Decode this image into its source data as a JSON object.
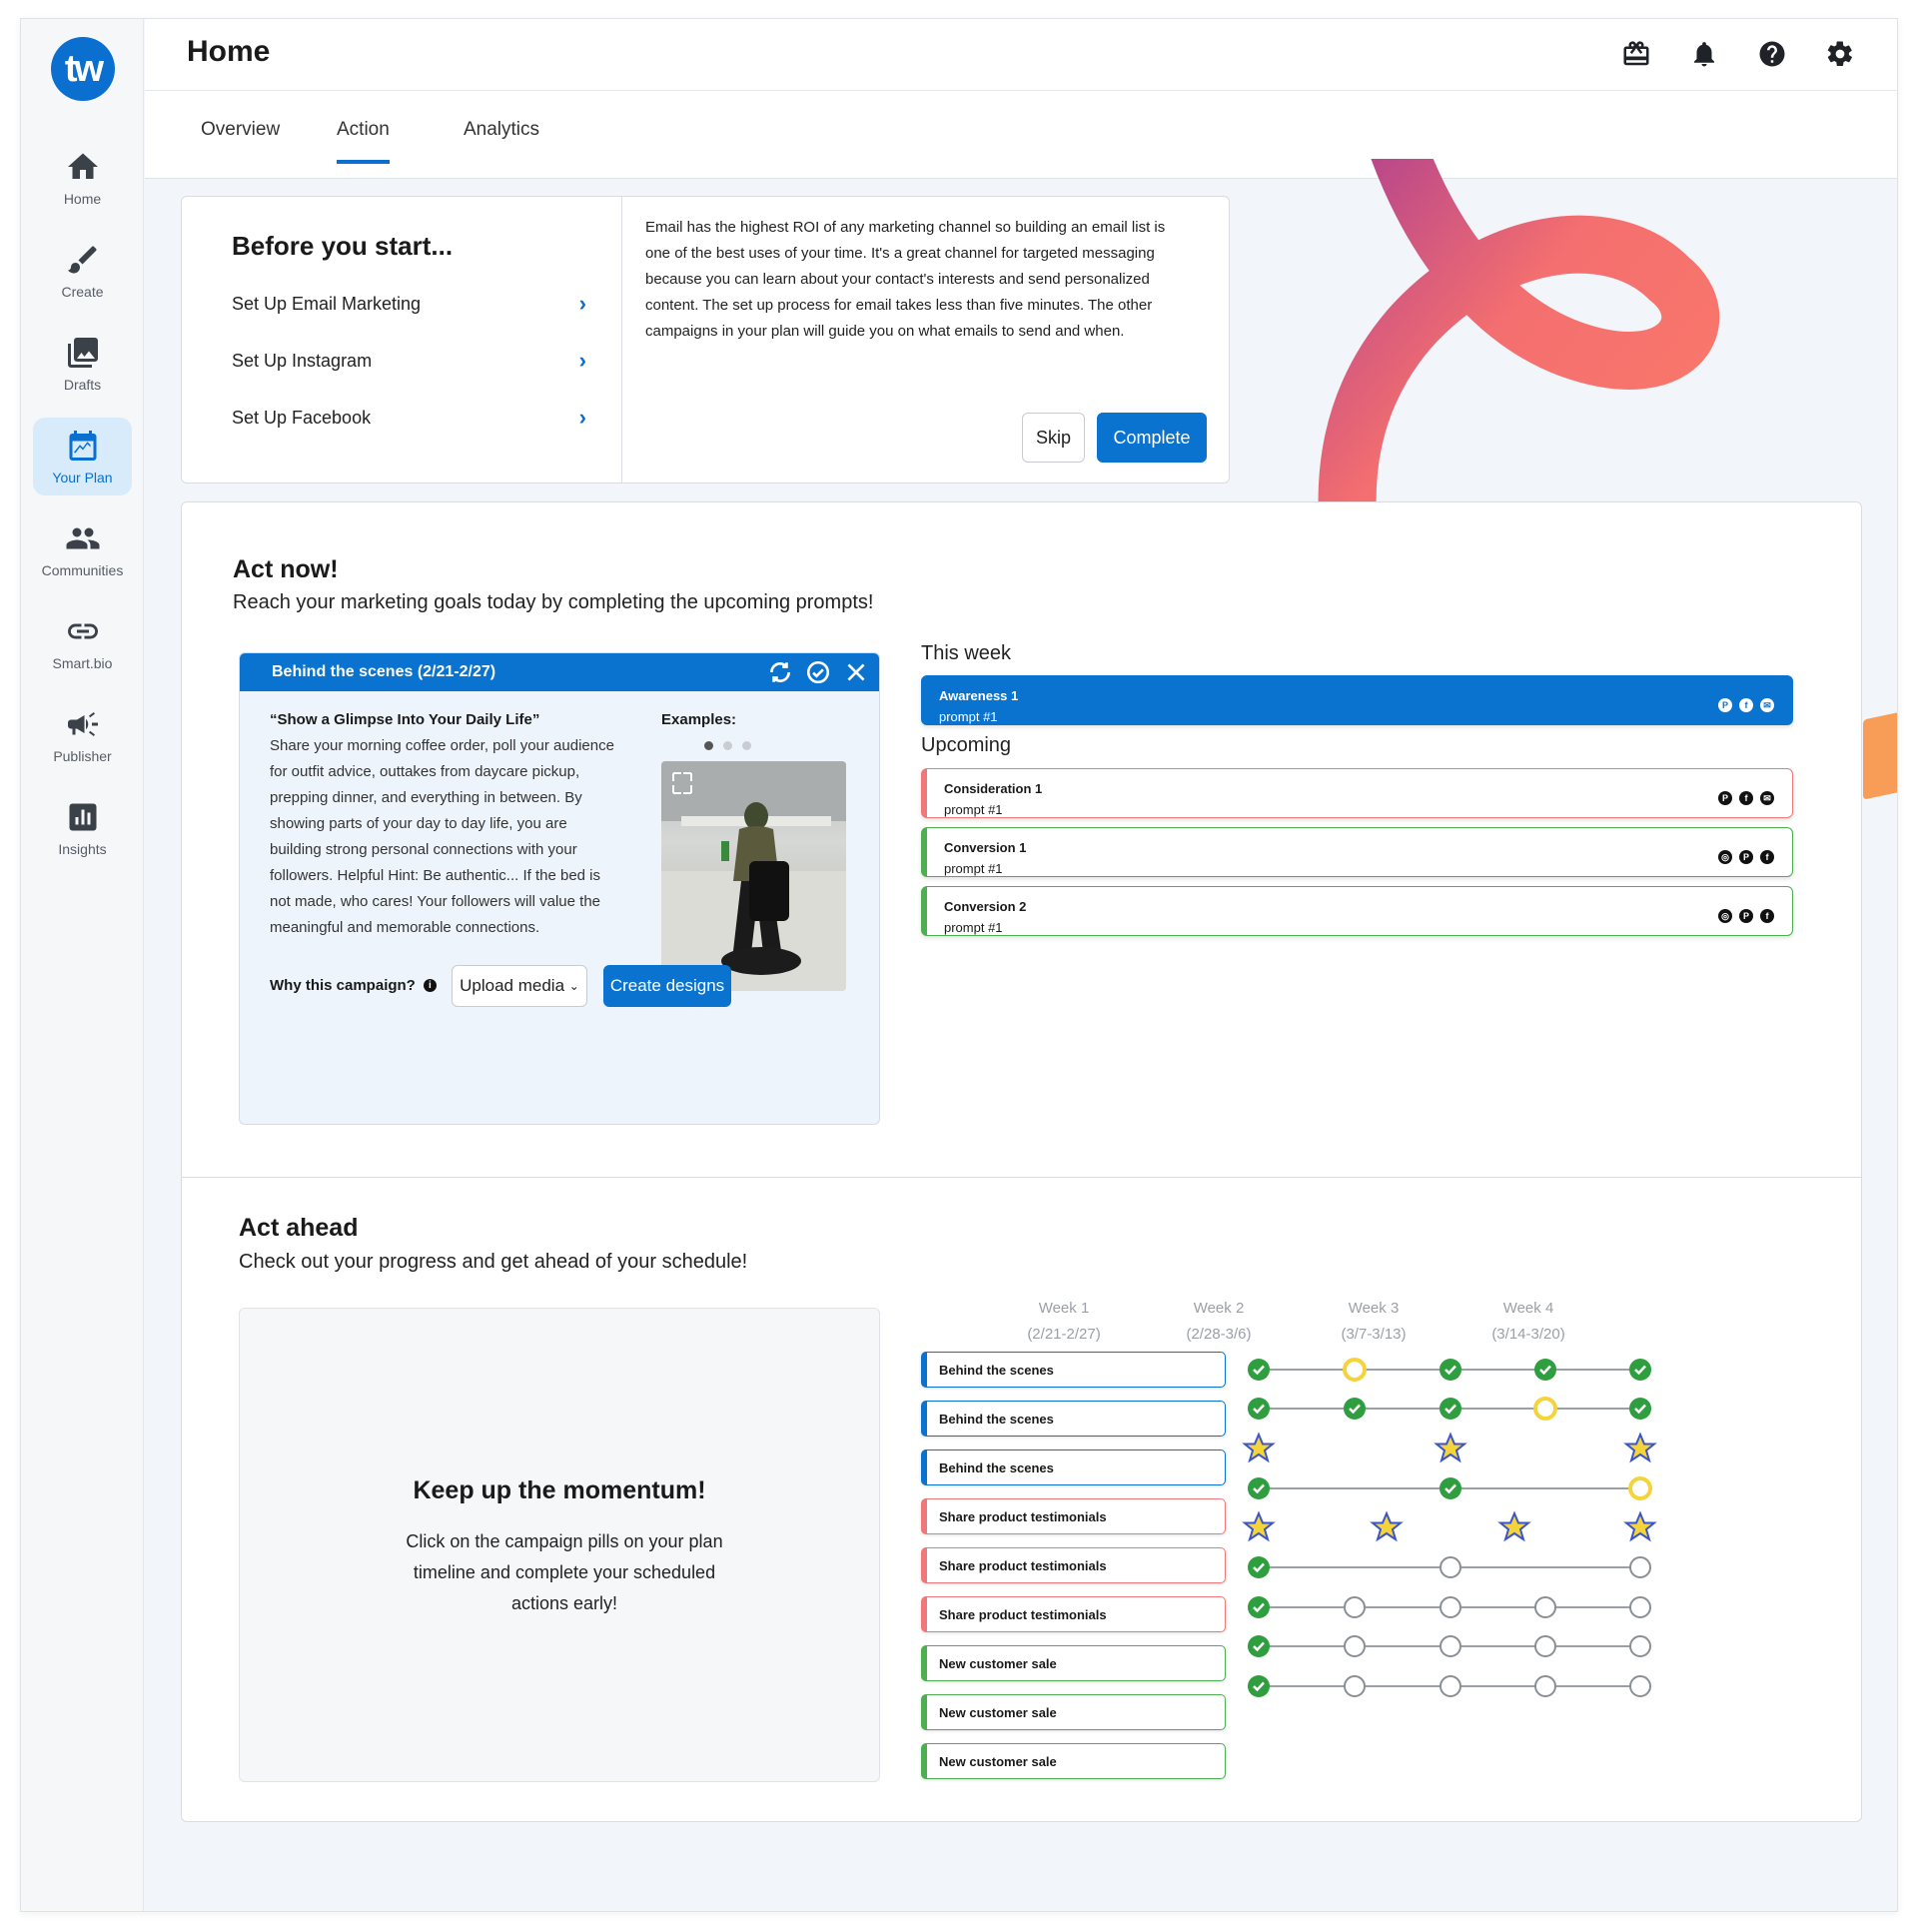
{
  "app": {
    "logo_text": "tw",
    "page_title": "Home"
  },
  "sidebar": {
    "items": [
      {
        "label": "Home",
        "icon": "home-icon"
      },
      {
        "label": "Create",
        "icon": "brush-icon"
      },
      {
        "label": "Drafts",
        "icon": "images-icon"
      },
      {
        "label": "Your Plan",
        "icon": "calendar-chart-icon",
        "active": true
      },
      {
        "label": "Communities",
        "icon": "people-icon"
      },
      {
        "label": "Smart.bio",
        "icon": "link-icon"
      },
      {
        "label": "Publisher",
        "icon": "megaphone-icon"
      },
      {
        "label": "Insights",
        "icon": "bar-chart-icon"
      }
    ]
  },
  "header_icons": [
    "gift-icon",
    "bell-icon",
    "help-icon",
    "gear-icon"
  ],
  "tabs": [
    {
      "label": "Overview"
    },
    {
      "label": "Action",
      "active": true
    },
    {
      "label": "Analytics"
    }
  ],
  "before_start": {
    "title": "Before you start...",
    "items": [
      "Set Up Email Marketing",
      "Set Up Instagram",
      "Set Up Facebook"
    ],
    "description": "Email has the highest ROI of any marketing channel so building an email list is one of the best uses of your time. It's a great channel for targeted messaging because you can learn about your contact's interests and send personalized content. The set up process for email takes less than five minutes. The other campaigns in your plan will guide you on what emails to send and when.",
    "skip_label": "Skip",
    "complete_label": "Complete"
  },
  "act_now": {
    "title": "Act now!",
    "subtitle": "Reach your marketing goals today by completing the upcoming prompts!",
    "prompt": {
      "header": "Behind the scenes (2/21-2/27)",
      "quote": "“Show a Glimpse Into Your Daily Life”",
      "body": "Share your morning coffee order, poll your audience for outfit advice, outtakes from daycare pickup, prepping dinner, and everything in between. By showing parts of your day to day life, you are building strong personal connections with your followers. Helpful Hint: Be authentic... If the bed is not made, who cares! Your followers will value the meaningful and memorable connections.",
      "why_label": "Why this campaign?",
      "examples_label": "Examples:",
      "upload_label": "Upload media",
      "create_label": "Create designs"
    },
    "this_week_label": "This week",
    "upcoming_label": "Upcoming",
    "this_week": [
      {
        "title": "Awareness 1",
        "sub": "prompt #1",
        "icons": [
          "P",
          "f",
          "✉"
        ]
      }
    ],
    "upcoming": [
      {
        "title": "Consideration 1",
        "sub": "prompt #1",
        "icons": [
          "P",
          "f",
          "✉"
        ],
        "color": "red"
      },
      {
        "title": "Conversion 1",
        "sub": "prompt #1",
        "icons": [
          "◎",
          "P",
          "f"
        ],
        "color": "green"
      },
      {
        "title": "Conversion 2",
        "sub": "prompt #1",
        "icons": [
          "◎",
          "P",
          "f"
        ],
        "color": "green"
      }
    ]
  },
  "act_ahead": {
    "title": "Act ahead",
    "subtitle": "Check out your progress and get ahead of your schedule!",
    "momentum_title": "Keep up the momentum!",
    "momentum_body": "Click on the campaign pills on your plan timeline and complete your scheduled actions early!",
    "weeks": [
      {
        "label": "Week 1",
        "range": "(2/21-2/27)"
      },
      {
        "label": "Week 2",
        "range": "(2/28-3/6)"
      },
      {
        "label": "Week 3",
        "range": "(3/7-3/13)"
      },
      {
        "label": "Week 4",
        "range": "(3/14-3/20)"
      }
    ],
    "campaigns": [
      {
        "label": "Behind the scenes",
        "color": "blue"
      },
      {
        "label": "Behind the scenes",
        "color": "blue"
      },
      {
        "label": "Behind the scenes",
        "color": "blue"
      },
      {
        "label": "Share product testimonials",
        "color": "red"
      },
      {
        "label": "Share product testimonials",
        "color": "red"
      },
      {
        "label": "Share product testimonials",
        "color": "red"
      },
      {
        "label": "New customer sale",
        "color": "green"
      },
      {
        "label": "New customer sale",
        "color": "green"
      },
      {
        "label": "New customer sale",
        "color": "green"
      }
    ]
  },
  "colors": {
    "primary": "#0a73cf",
    "red": "#f0777a",
    "green": "#4caf50",
    "yellow": "#f5d33b"
  }
}
